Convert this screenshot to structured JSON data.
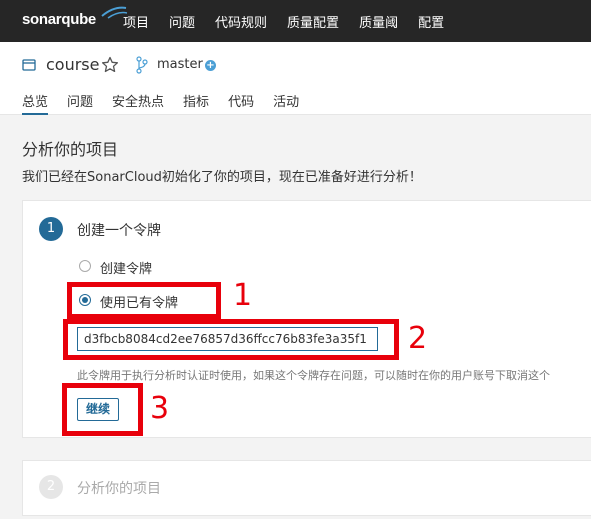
{
  "topbar": {
    "logo_text": "sonarqube",
    "nav": [
      "项目",
      "问题",
      "代码规则",
      "质量配置",
      "质量阈",
      "配置"
    ]
  },
  "project": {
    "name": "course",
    "branch": "master",
    "tabs": [
      "总览",
      "问题",
      "安全热点",
      "指标",
      "代码",
      "活动"
    ],
    "active_tab": "总览"
  },
  "main": {
    "title": "分析你的项目",
    "subtitle": "我们已经在SonarCloud初始化了你的项目，现在已准备好进行分析！"
  },
  "step1": {
    "number": "1",
    "title": "创建一个令牌",
    "radio_create": "创建令牌",
    "radio_existing": "使用已有令牌",
    "selected": "使用已有令牌",
    "token_value": "d3fbcb8084cd2ee76857d36ffcc76b83fe3a35f1",
    "help": "此令牌用于执行分析时认证时使用，如果这个令牌存在问题，可以随时在你的用户账号下取消这个",
    "continue_label": "继续"
  },
  "step2": {
    "number": "2",
    "title": "分析你的项目"
  },
  "annotations": [
    "1",
    "2",
    "3"
  ],
  "colors": {
    "topbar": "#262626",
    "accent": "#236a97",
    "annotation": "#e8000b"
  }
}
